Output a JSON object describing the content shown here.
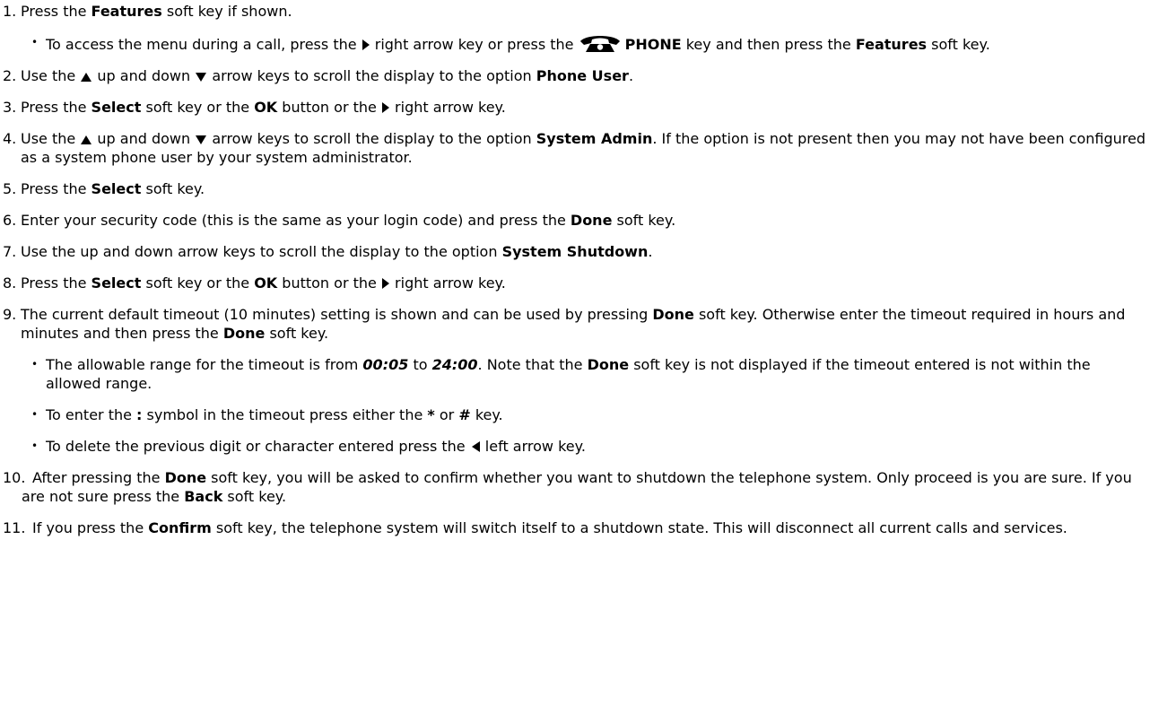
{
  "steps": [
    {
      "num": "1.",
      "t1": "Press the ",
      "b1": "Features",
      "t2": " soft key if shown."
    },
    {
      "num": "2.",
      "t1": "Use the ",
      "t2": " up and down ",
      "t3": " arrow keys to scroll the display to the option ",
      "b1": "Phone User",
      "t4": "."
    },
    {
      "num": "3.",
      "t1": "Press the ",
      "b1": "Select",
      "t2": " soft key or the ",
      "b2": "OK",
      "t3": " button or the ",
      "t4": " right arrow key."
    },
    {
      "num": "4.",
      "t1": "Use the ",
      "t2": " up and down ",
      "t3": " arrow keys to scroll the display to the option ",
      "b1": "System Admin",
      "t4": ". If the option is not present then you may not have been configured as a system phone user by your system administrator."
    },
    {
      "num": "5.",
      "t1": "Press the ",
      "b1": "Select",
      "t2": " soft key."
    },
    {
      "num": "6.",
      "t1": "Enter your security code (this is the same as your login code) and press the ",
      "b1": "Done",
      "t2": " soft key."
    },
    {
      "num": "7.",
      "t1": "Use the up and down arrow keys to scroll the display to the option ",
      "b1": "System Shutdown",
      "t2": "."
    },
    {
      "num": "8.",
      "t1": "Press the ",
      "b1": "Select",
      "t2": " soft key or the ",
      "b2": "OK",
      "t3": " button or the ",
      "t4": " right arrow key."
    },
    {
      "num": "9.",
      "t1": "The current default timeout (10 minutes) setting is shown and can be used by pressing ",
      "b1": "Done",
      "t2": " soft key. Otherwise enter the timeout required in hours and minutes and then press the ",
      "b2": "Done",
      "t3": " soft key."
    },
    {
      "num": "10.",
      "t1": "After pressing the ",
      "b1": "Done",
      "t2": " soft key, you will be asked to confirm whether you want to shutdown the telephone system. Only proceed is you are sure. If you are not sure press the ",
      "b2": "Back",
      "t3": " soft key."
    },
    {
      "num": "11.",
      "t1": "If you press the ",
      "b1": "Confirm",
      "t2": " soft key, the telephone system will switch itself to a shutdown state. This will disconnect all current calls and services."
    }
  ],
  "step1_bullet": {
    "t1": "To access the menu during a call, press the ",
    "t2": " right arrow key or press the ",
    "b1": "PHONE",
    "t3": " key and then press the ",
    "b2": "Features",
    "t4": " soft key."
  },
  "step9_bullets": [
    {
      "t1": "The allowable range for the timeout is from ",
      "bi1": "00:05",
      "t2": " to ",
      "bi2": "24:00",
      "t3": ". Note that the ",
      "b1": "Done",
      "t4": " soft key is not displayed if the timeout entered is not within the allowed range."
    },
    {
      "t1": "To enter the ",
      "b1": ":",
      "t2": " symbol in the timeout press either the ",
      "b2": "*",
      "t3": " or ",
      "b3": "#",
      "t4": " key."
    },
    {
      "t1": "To delete the previous digit or character entered press the ",
      "t2": " left arrow key."
    }
  ],
  "bullet_glyph": "•",
  "colors": {
    "text": "#000000",
    "background": "#ffffff"
  }
}
